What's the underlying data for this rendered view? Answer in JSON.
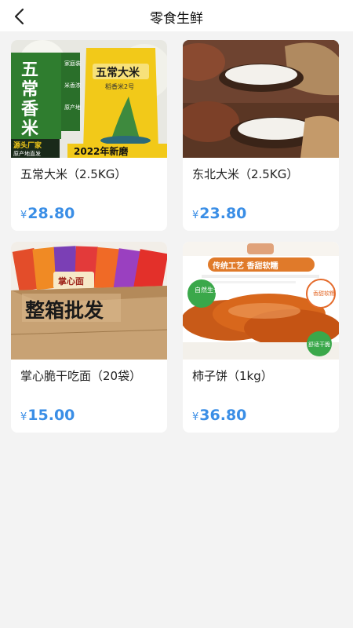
{
  "header": {
    "title": "零食生鲜",
    "back_icon": "chevron-left-icon"
  },
  "currency_symbol": "¥",
  "colors": {
    "background": "#f3f3f3",
    "card": "#ffffff",
    "price": "#3a8ee6"
  },
  "products": [
    {
      "name": "五常大米（2.5KG）",
      "price": "28.80",
      "image_text": {
        "brand": [
          "五",
          "常",
          "香",
          "米"
        ],
        "features": [
          "家庭装",
          "米香浓",
          "原产地"
        ],
        "bag_title": "五常大米",
        "bag_subtitle": "稻香米2号",
        "origin_title": "源头厂家",
        "origin_sub": "原产地直发",
        "banner": "2022年新磨"
      }
    },
    {
      "name": "东北大米（2.5KG）",
      "price": "23.80"
    },
    {
      "name": "掌心脆干吃面（20袋）",
      "price": "15.00",
      "image_text": {
        "box_label": "整箱批发",
        "pack_label": "掌心面"
      }
    },
    {
      "name": "柿子饼（1kg）",
      "price": "36.80",
      "image_text": {
        "title": "传统工艺 香甜软糯",
        "badge_left": "自然生长",
        "badge_right_top": "香甜软糯",
        "badge_right_bottom": "舒适干脆"
      }
    }
  ]
}
